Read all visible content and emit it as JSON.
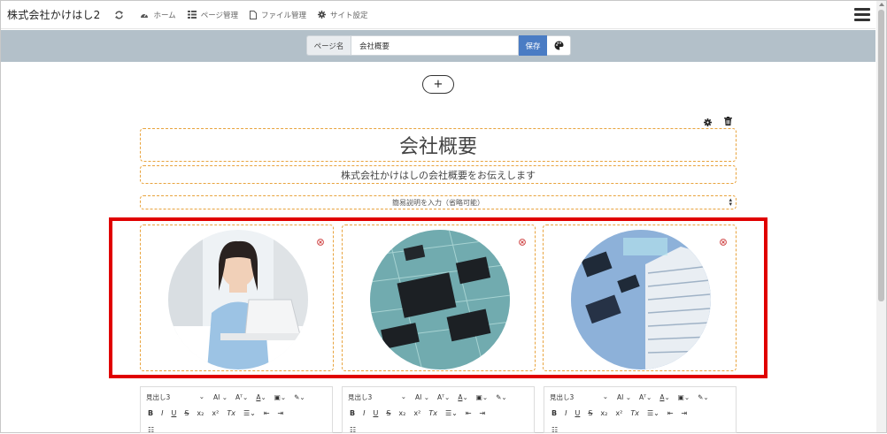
{
  "nav": {
    "brand": "株式会社かけはし2",
    "items": [
      {
        "label": "ホーム",
        "icon": "dashboard-icon"
      },
      {
        "label": "ページ管理",
        "icon": "page-manage-icon"
      },
      {
        "label": "ファイル管理",
        "icon": "file-icon"
      },
      {
        "label": "サイト設定",
        "icon": "gear-icon"
      }
    ]
  },
  "pagebar": {
    "label": "ページ名",
    "value": "会社概要",
    "save": "保存"
  },
  "add_button": "+",
  "content": {
    "title": "会社概要",
    "subtitle": "株式会社かけはしの会社概要をお伝えします",
    "description_placeholder": "簡易説明を入力（省略可能）"
  },
  "editor": {
    "heading_select": "見出し3",
    "font_size": "AI",
    "toolbar_row2": [
      "B",
      "I",
      "U",
      "S",
      "x₂",
      "x²",
      "Tx"
    ]
  },
  "images": [
    {
      "alt": "woman-at-laptop"
    },
    {
      "alt": "circuit-board"
    },
    {
      "alt": "building-circuit"
    }
  ],
  "colors": {
    "accent_blue": "#4a7cc4",
    "highlight_red": "#e00000",
    "dashed_orange": "#e8a33d",
    "pagebar_bg": "#b3c0c9"
  }
}
